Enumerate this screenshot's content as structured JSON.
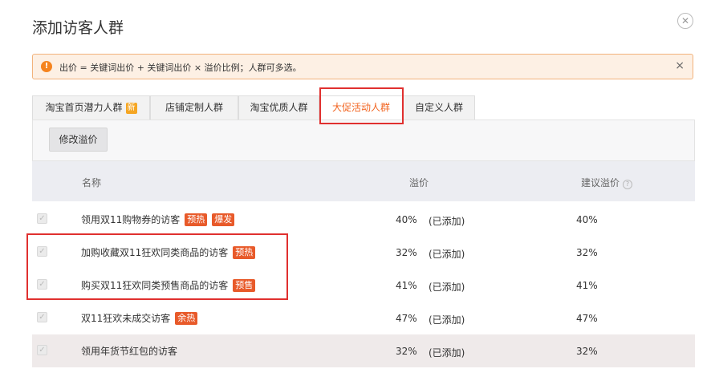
{
  "dialog": {
    "title": "添加访客人群",
    "close_icon": "close-circle-icon"
  },
  "alert": {
    "icon": "exclamation-circle-icon",
    "text": "出价 = 关键词出价 + 关键词出价 × 溢价比例；人群可多选。",
    "close": "×"
  },
  "tabs": [
    {
      "label": "淘宝首页潜力人群",
      "badge": "新"
    },
    {
      "label": "店铺定制人群"
    },
    {
      "label": "淘宝优质人群"
    },
    {
      "label": "大促活动人群",
      "active": true
    },
    {
      "label": "自定义人群"
    }
  ],
  "toolbar": {
    "edit_premium_label": "修改溢价"
  },
  "table": {
    "headers": {
      "name": "名称",
      "premium": "溢价",
      "suggested": "建议溢价"
    },
    "rows": [
      {
        "name": "领用双11购物券的访客",
        "tags": [
          "预热",
          "爆发"
        ],
        "premium": "40%",
        "status": "(已添加)",
        "suggested": "40%"
      },
      {
        "name": "加购收藏双11狂欢同类商品的访客",
        "tags": [
          "预热"
        ],
        "premium": "32%",
        "status": "(已添加)",
        "suggested": "32%"
      },
      {
        "name": "购买双11狂欢同类预售商品的访客",
        "tags": [
          "预售"
        ],
        "premium": "41%",
        "status": "(已添加)",
        "suggested": "41%"
      },
      {
        "name": "双11狂欢未成交访客",
        "tags": [
          "余热"
        ],
        "premium": "47%",
        "status": "(已添加)",
        "suggested": "47%"
      },
      {
        "name": "领用年货节红包的访客",
        "tags": [],
        "premium": "32%",
        "status": "(已添加)",
        "suggested": "32%"
      }
    ]
  },
  "colors": {
    "accent": "#f26522",
    "tag": "#e85a2a",
    "highlight_border": "#e0302f",
    "alert_bg": "#fdf0e4"
  }
}
